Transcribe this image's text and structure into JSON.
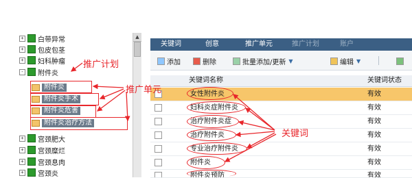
{
  "tree": {
    "items": [
      {
        "label": "白带异常",
        "toggle": "+"
      },
      {
        "label": "包皮包茎",
        "toggle": "+"
      },
      {
        "label": "妇科肿瘤",
        "toggle": "+"
      },
      {
        "label": "附件炎",
        "toggle": "-"
      }
    ],
    "sub_items": [
      {
        "label": "附件炎"
      },
      {
        "label": "附件炎手术"
      },
      {
        "label": "附件炎危害"
      },
      {
        "label": "附件炎治疗方法"
      }
    ],
    "items_after": [
      {
        "label": "宫颈肥大",
        "toggle": "+"
      },
      {
        "label": "宫颈糜烂",
        "toggle": "+"
      },
      {
        "label": "宫颈息肉",
        "toggle": "+"
      },
      {
        "label": "宫颈炎",
        "toggle": "+"
      }
    ]
  },
  "tabs": [
    {
      "label": "关键词",
      "state": "active"
    },
    {
      "label": "创意",
      "state": "normal"
    },
    {
      "label": "推广单元",
      "state": "normal"
    },
    {
      "label": "推广计划",
      "state": "dim"
    },
    {
      "label": "账户",
      "state": "dim"
    }
  ],
  "toolbar": {
    "add": "添加",
    "delete": "删除",
    "batch": "批量添加/更新",
    "edit": "编辑"
  },
  "table": {
    "headers": [
      "关键词名称",
      "关键词状态"
    ],
    "rows": [
      {
        "keyword": "女性附件炎",
        "status": "有效"
      },
      {
        "keyword": "妇科炎症附件炎",
        "status": "有效"
      },
      {
        "keyword": "治疗附件炎症",
        "status": "有效"
      },
      {
        "keyword": "治疗附件炎",
        "status": "有效"
      },
      {
        "keyword": "专业治疗附件炎",
        "status": "有效"
      },
      {
        "keyword": "附件炎",
        "status": "有效"
      },
      {
        "keyword": "附件炎预防",
        "status": "有效"
      }
    ]
  },
  "annotations": {
    "plan": "推广计划",
    "unit": "推广单元",
    "keyword": "关键词"
  },
  "colors": {
    "annotation": "#e8262b",
    "tab_bar": "#3b5f84",
    "selected_row": "#f7c66a"
  }
}
